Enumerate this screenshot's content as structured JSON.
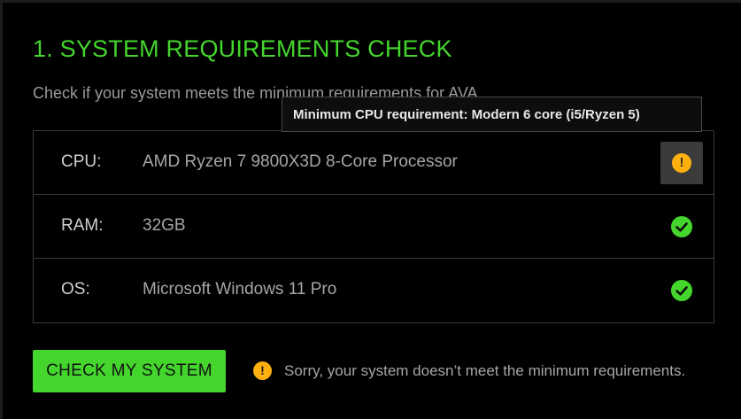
{
  "section": {
    "title": "1. SYSTEM REQUIREMENTS CHECK",
    "subtitle": "Check if your system meets the minimum requirements for AVA"
  },
  "requirements": [
    {
      "label": "CPU:",
      "value": "AMD Ryzen 7 9800X3D 8-Core Processor",
      "status": "warning",
      "status_icon": "info-warning-icon"
    },
    {
      "label": "RAM:",
      "value": "32GB",
      "status": "ok",
      "status_icon": "check-circle-icon"
    },
    {
      "label": "OS:",
      "value": "Microsoft Windows 11 Pro",
      "status": "ok",
      "status_icon": "check-circle-icon"
    }
  ],
  "tooltip": {
    "text": "Minimum CPU requirement: Modern 6 core (i5/Ryzen 5)"
  },
  "actions": {
    "check_button_label": "CHECK MY SYSTEM"
  },
  "result": {
    "icon": "warning-icon",
    "glyph": "!",
    "message": "Sorry, your system doesn’t meet the minimum requirements."
  },
  "colors": {
    "accent": "#44d62c",
    "warning": "#ffb00f",
    "background": "#000000"
  }
}
